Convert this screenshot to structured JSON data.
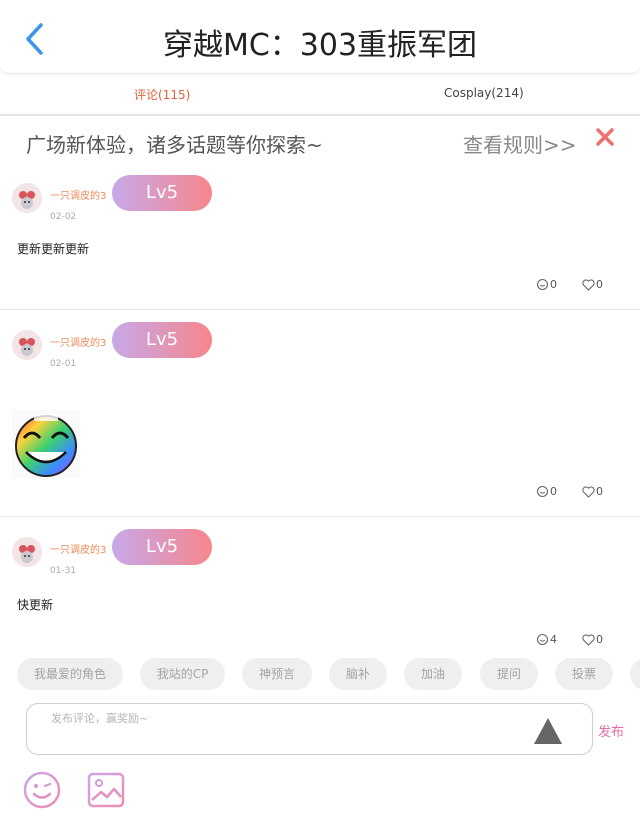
{
  "header": {
    "title": "穿越MC：303重振军团"
  },
  "tabs": [
    {
      "label": "评论(115)",
      "active": true
    },
    {
      "label": "Cosplay(214)",
      "active": false
    }
  ],
  "banner": {
    "text": "广场新体验，诸多话题等你探索~",
    "rules": "查看规则>>"
  },
  "posts": [
    {
      "username": "一只调皮的3",
      "level": "Lv5",
      "date": "02-02",
      "text": "更新更新更新",
      "comments": "0",
      "likes": "0",
      "has_image": false
    },
    {
      "username": "一只调皮的3",
      "level": "Lv5",
      "date": "02-01",
      "text": "",
      "comments": "0",
      "likes": "0",
      "has_image": true
    },
    {
      "username": "一只调皮的3",
      "level": "Lv5",
      "date": "01-31",
      "text": "快更新",
      "comments": "4",
      "likes": "0",
      "has_image": false
    }
  ],
  "topic_tags": [
    "我最爱的角色",
    "我站的CP",
    "神预言",
    "脑补",
    "加油",
    "提问",
    "投票"
  ],
  "composer": {
    "placeholder": "发布评论，赢奖励~",
    "publish_label": "发布"
  },
  "colors": {
    "accent": "#e4603f",
    "level_gradient": [
      "#c7a8ea",
      "#f6868c"
    ],
    "close": "#f07070",
    "back": "#3a96e8",
    "publish": "#e56aa5"
  },
  "icons": {
    "back": "chevron-left-icon",
    "close": "close-icon",
    "comment": "comment-bubble-icon",
    "like": "heart-icon",
    "send": "triangle-icon",
    "emoji": "emoji-icon",
    "image": "image-icon"
  }
}
